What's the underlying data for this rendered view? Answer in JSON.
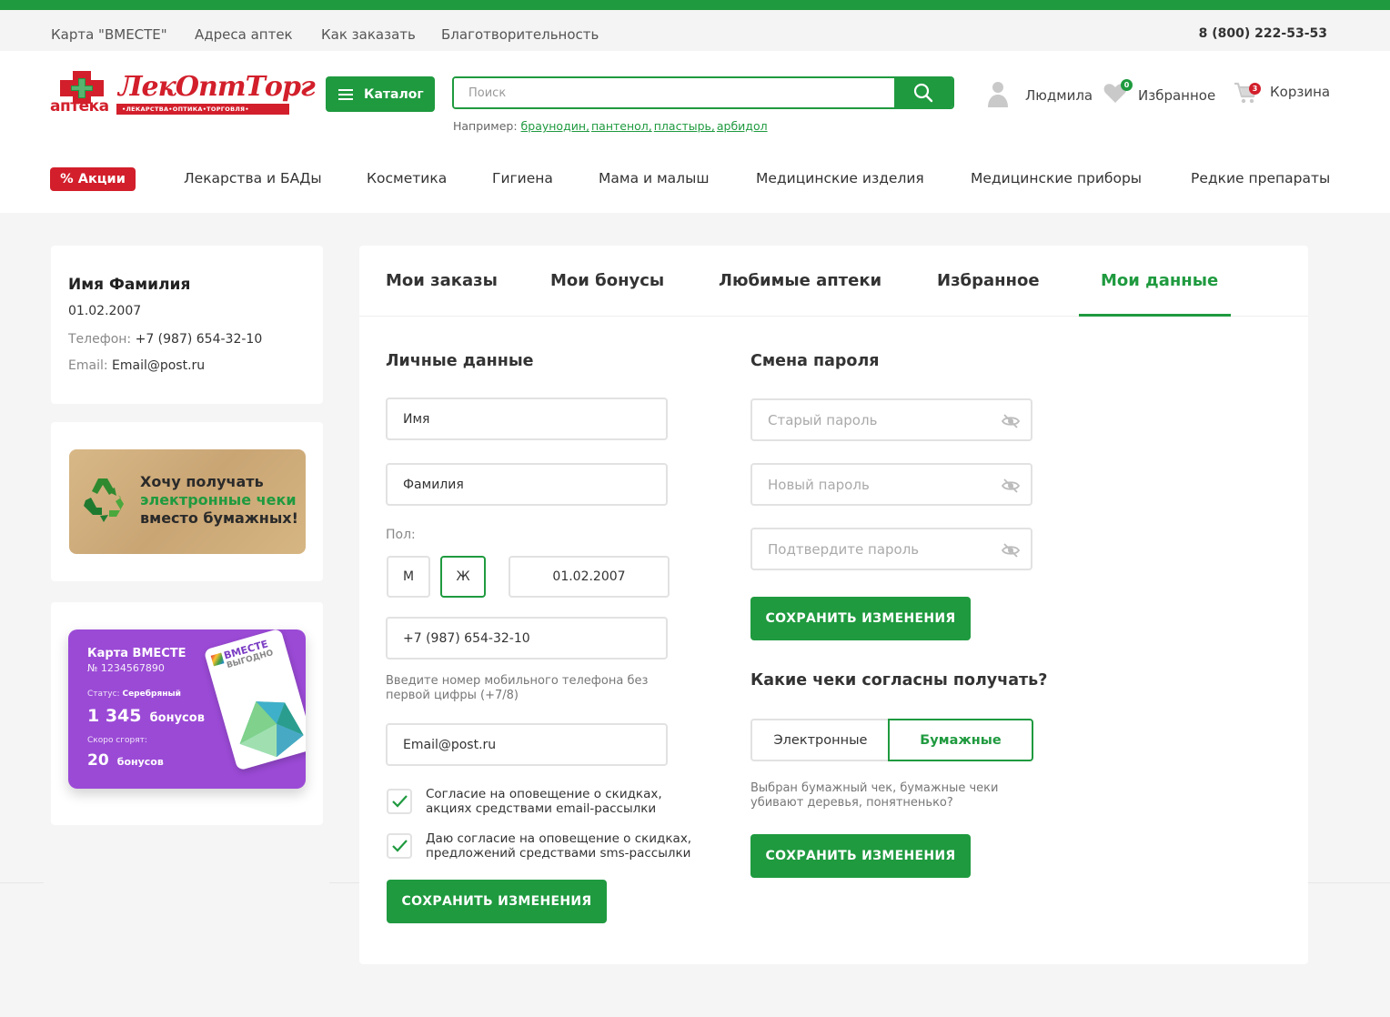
{
  "topbar": {
    "links": [
      "Карта \"ВМЕСТЕ\"",
      "Адреса аптек",
      "Как заказать",
      "Благотворительность"
    ],
    "phone": "8 (800) 222-53-53"
  },
  "logo": {
    "small": "аптека",
    "main": "ЛекОптТорг",
    "strip": "•ЛЕКАРСТВА•ОПТИКА•ТОРГОВЛЯ•"
  },
  "header": {
    "catalog_label": "Каталог",
    "search_placeholder": "Поиск",
    "examples_label": "Например:",
    "examples": [
      "браунодин,",
      "пантенол,",
      "пластырь,",
      "арбидол"
    ],
    "user_name": "Людмила",
    "favorites_label": "Избранное",
    "favorites_count": "0",
    "cart_label": "Корзина",
    "cart_count": "3"
  },
  "nav": {
    "promo": "% Акции",
    "items": [
      "Лекарства и БАДы",
      "Косметика",
      "Гигиена",
      "Мама и малыш",
      "Медицинские изделия",
      "Медицинские приборы",
      "Редкие препараты"
    ]
  },
  "profile": {
    "name": "Имя Фамилия",
    "birthdate": "01.02.2007",
    "phone_label": "Телефон:",
    "phone": "+7 (987) 654-32-10",
    "email_label": "Email:",
    "email": "Email@post.ru"
  },
  "eco_banner": {
    "line1": "Хочу получать",
    "line2": "электронные чеки",
    "line3": "вместо бумажных!"
  },
  "bonus_card": {
    "title": "Карта ВМЕСТЕ",
    "number": "№ 1234567890",
    "status_label": "Статус:",
    "status": "Серебряный",
    "bonus_value": "1 345",
    "bonus_unit": "бонусов",
    "expire_label": "Скоро сгорят:",
    "expire_value": "20",
    "expire_unit": "бонусов",
    "logo_line1": "ВМЕСТЕ",
    "logo_line2": "ВЫГОДНО"
  },
  "tabs": [
    "Мои заказы",
    "Мои бонусы",
    "Любимые аптеки",
    "Избранное",
    "Мои данные"
  ],
  "personal": {
    "title": "Личные данные",
    "first_name": "Имя",
    "last_name": "Фамилия",
    "sex_label": "Пол:",
    "sex_m": "М",
    "sex_f": "Ж",
    "birthdate": "01.02.2007",
    "phone": "+7 (987) 654-32-10",
    "phone_hint": "Введите номер мобильного телефона без первой цифры (+7/8)",
    "email": "Email@post.ru",
    "consent_email": "Согласие на оповещение о скидках, акциях средствами email-рассылки",
    "consent_sms": "Даю согласие на оповещение о скидках, предложений средствами sms-рассылки",
    "save": "СОХРАНИТЬ ИЗМЕНЕНИЯ"
  },
  "password": {
    "title": "Смена пароля",
    "old_placeholder": "Старый пароль",
    "new_placeholder": "Новый пароль",
    "confirm_placeholder": "Подтвердите пароль",
    "save": "СОХРАНИТЬ ИЗМЕНЕНИЯ"
  },
  "receipts": {
    "title": "Какие чеки согласны получать?",
    "option_electronic": "Электронные",
    "option_paper": "Бумажные",
    "selected": "Бумажные",
    "hint": "Выбран бумажный чек, бумажные чеки убивают деревья, понятненько?",
    "save": "СОХРАНИТЬ ИЗМЕНЕНИЯ"
  },
  "colors": {
    "accent": "#1f9a3f",
    "brand_red": "#d21f2b",
    "card_purple": "#9b4ad6"
  }
}
